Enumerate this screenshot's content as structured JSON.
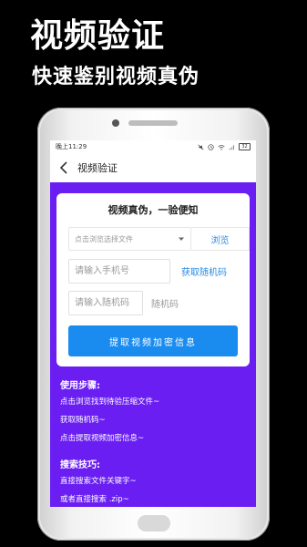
{
  "promo": {
    "title": "视频验证",
    "subtitle": "快速鉴别视频真伪"
  },
  "status_bar": {
    "time": "晚上11:29",
    "battery": "32"
  },
  "nav": {
    "title": "视频验证"
  },
  "card": {
    "title": "视频真伪，一验便知",
    "file_placeholder": "点击浏览选择文件",
    "browse_label": "浏览",
    "phone_placeholder": "请输入手机号",
    "get_code_label": "获取随机码",
    "code_placeholder": "请输入随机码",
    "code_display": "随机码",
    "submit_label": "提取视频加密信息"
  },
  "steps": {
    "title": "使用步骤:",
    "items": [
      "点击浏览找到待验压缩文件~",
      "获取随机码~",
      "点击提取视频加密信息~"
    ]
  },
  "tips": {
    "title": "搜索技巧:",
    "items": [
      "直接搜索文件关键字~",
      "或者直接搜索 .zip~"
    ]
  },
  "colors": {
    "accent_purple": "#6a1ef2",
    "button_blue": "#1a8cf0",
    "link_blue": "#2a8be4"
  }
}
